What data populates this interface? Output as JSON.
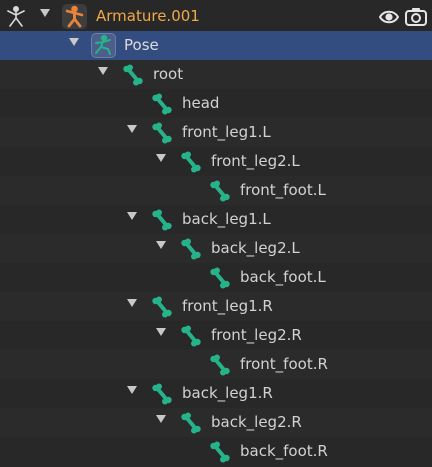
{
  "outliner": {
    "armature": {
      "label": "Armature.001",
      "expanded": true
    },
    "pose": {
      "label": "Pose",
      "expanded": true,
      "selected": true
    },
    "bones": [
      {
        "label": "root",
        "depth": 0,
        "expanded": true
      },
      {
        "label": "head",
        "depth": 1,
        "expanded": null
      },
      {
        "label": "front_leg1.L",
        "depth": 1,
        "expanded": true
      },
      {
        "label": "front_leg2.L",
        "depth": 2,
        "expanded": true
      },
      {
        "label": "front_foot.L",
        "depth": 3,
        "expanded": null
      },
      {
        "label": "back_leg1.L",
        "depth": 1,
        "expanded": true
      },
      {
        "label": "back_leg2.L",
        "depth": 2,
        "expanded": true
      },
      {
        "label": "back_foot.L",
        "depth": 3,
        "expanded": null
      },
      {
        "label": "front_leg1.R",
        "depth": 1,
        "expanded": true
      },
      {
        "label": "front_leg2.R",
        "depth": 2,
        "expanded": true
      },
      {
        "label": "front_foot.R",
        "depth": 3,
        "expanded": null
      },
      {
        "label": "back_leg1.R",
        "depth": 1,
        "expanded": true
      },
      {
        "label": "back_leg2.R",
        "depth": 2,
        "expanded": true
      },
      {
        "label": "back_foot.R",
        "depth": 3,
        "expanded": null
      }
    ],
    "icons": {
      "row_type": "armature-data-icon",
      "armature_object": "armature-object-icon",
      "pose": "pose-icon",
      "bone": "bone-icon",
      "visibility": "eye-icon",
      "render": "camera-icon"
    },
    "colors": {
      "selected_row": "#334d80",
      "armature_label": "#f0a84a",
      "bone_icon": "#27b38a",
      "armature_icon": "#e8833a"
    }
  }
}
